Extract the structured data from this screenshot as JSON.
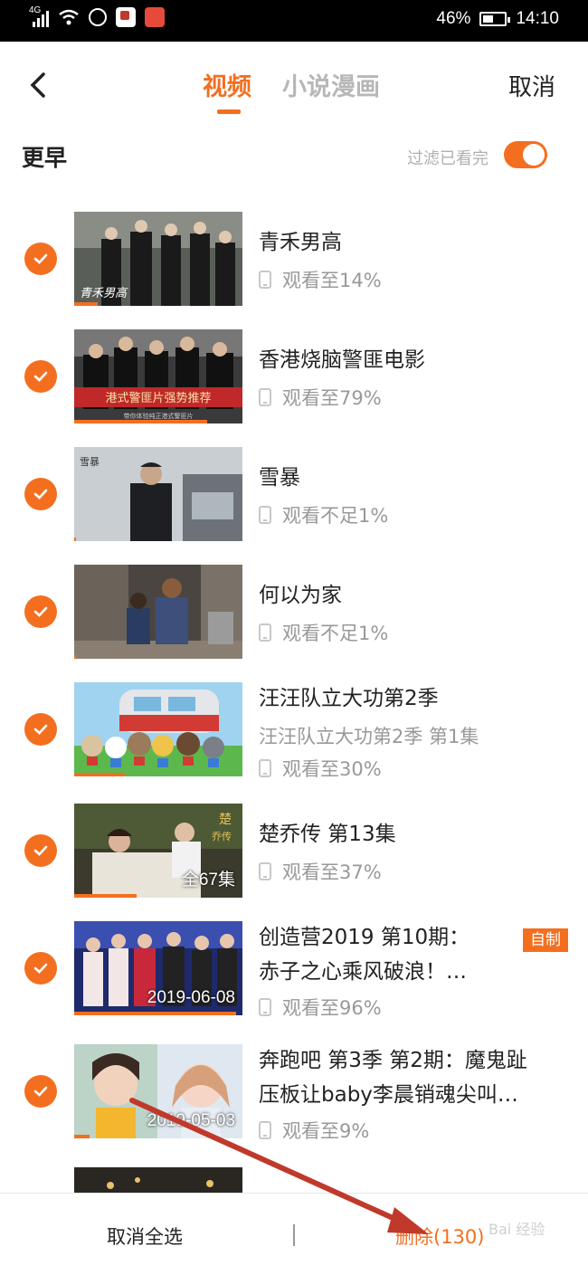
{
  "status_bar": {
    "network": "4G",
    "battery": "46%",
    "time": "14:10"
  },
  "header": {
    "back_icon": "chevron-left-icon",
    "tabs": [
      {
        "label": "视频",
        "active": true
      },
      {
        "label": "小说漫画",
        "active": false
      }
    ],
    "cancel_label": "取消"
  },
  "section": {
    "title": "更早",
    "filter_label": "过滤已看完",
    "filter_on": true
  },
  "items": [
    {
      "title": "青禾男高",
      "watched": "观看至14%",
      "progress": 0.14
    },
    {
      "title": "香港烧脑警匪电影",
      "watched": "观看至79%",
      "progress": 0.79
    },
    {
      "title": "雪暴",
      "watched": "观看不足1%",
      "progress": 0.01
    },
    {
      "title": "何以为家",
      "watched": "观看不足1%",
      "progress": 0.01
    },
    {
      "title": "汪汪队立大功第2季",
      "subtitle": "汪汪队立大功第2季 第1集",
      "watched": "观看至30%",
      "progress": 0.3
    },
    {
      "title": "楚乔传 第13集",
      "watched": "观看至37%",
      "thumb_tag": "全67集",
      "progress": 0.37
    },
    {
      "title_line1": "创造营2019 第10期：",
      "title_line2": "赤子之心乘风破浪！…",
      "badge": "自制",
      "watched": "观看至96%",
      "thumb_tag": "2019-06-08",
      "progress": 0.96
    },
    {
      "title_line1": "奔跑吧 第3季 第2期：魔鬼趾",
      "title_line2": "压板让baby李晨销魂尖叫…",
      "watched": "观看至9%",
      "thumb_tag": "2019-05-03",
      "progress": 0.09
    }
  ],
  "bottom_bar": {
    "select_all_label": "取消全选",
    "delete_label": "删除(130)"
  },
  "colors": {
    "accent": "#f36f1f",
    "annotation_arrow": "#c0392b"
  }
}
